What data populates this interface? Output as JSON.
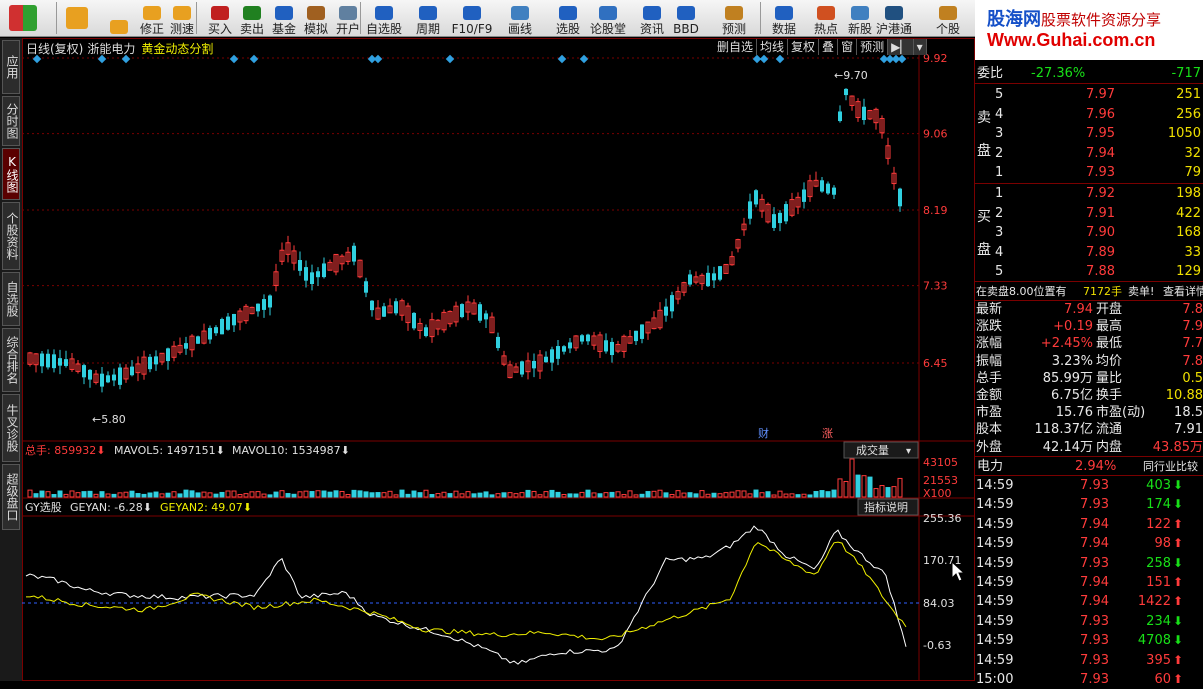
{
  "toolbar": {
    "buttons": [
      {
        "label": "",
        "icon": "flag-icon"
      },
      {
        "label": "",
        "icon": "back-arrow-icon"
      },
      {
        "label": "",
        "icon": "down-arrow-icon"
      },
      {
        "label": "修正",
        "icon": "clock-icon"
      },
      {
        "label": "测速",
        "icon": "timer-icon"
      },
      {
        "label": "买入",
        "icon": "buy-icon"
      },
      {
        "label": "卖出",
        "icon": "sell-icon"
      },
      {
        "label": "基金",
        "icon": "fund-icon"
      },
      {
        "label": "模拟",
        "icon": "hammer-icon"
      },
      {
        "label": "开户",
        "icon": "pe-icon"
      },
      {
        "label": "自选股",
        "icon": "star-icon"
      },
      {
        "label": "周期",
        "icon": "period-icon"
      },
      {
        "label": "F10/F9",
        "icon": "f10-icon"
      },
      {
        "label": "画线",
        "icon": "pen-icon"
      },
      {
        "label": "选股",
        "icon": "screen-icon"
      },
      {
        "label": "论股堂",
        "icon": "talk-icon"
      },
      {
        "label": "资讯",
        "icon": "news-icon"
      },
      {
        "label": "BBD",
        "icon": "bbd-icon"
      },
      {
        "label": "预测",
        "icon": "forecast-icon"
      },
      {
        "label": "数据",
        "icon": "data-icon"
      },
      {
        "label": "热点",
        "icon": "hot-icon"
      },
      {
        "label": "新股",
        "icon": "ipo-icon"
      },
      {
        "label": "沪港通",
        "icon": "hk-icon"
      },
      {
        "label": "个股",
        "icon": "stock-icon"
      }
    ]
  },
  "banner": {
    "line1a": "股海网",
    "line1b": "股票软件资源分享",
    "line2": "Www.Guhai.com.cn"
  },
  "side_tabs": [
    "应用",
    "分时图",
    "K线图",
    "个股资料",
    "自选股",
    "综合排名",
    "牛叉诊股",
    "超级盘口"
  ],
  "chart": {
    "title_period": "日线(复权)",
    "title_name": "浙能电力",
    "title_indicator": "黄金动态分割",
    "tools": [
      "删自选",
      "均线",
      "复权",
      "叠",
      "窗",
      "预测"
    ],
    "price_axis": [
      "9.92",
      "9.06",
      "8.19",
      "7.33",
      "6.45"
    ],
    "max_label": "9.70",
    "min_label": "5.80",
    "markers": [
      "财",
      "涨"
    ],
    "volume": {
      "label": "总手: 859932",
      "mavol5": "MAVOL5: 1497151",
      "mavol10": "MAVOL10: 1534987",
      "selector": "成交量",
      "axis": [
        "43105",
        "21553",
        "X100"
      ]
    },
    "indicator": {
      "name": "GY选股",
      "geyan": "GEYAN: -6.28",
      "geyan2": "GEYAN2: 49.07",
      "help": "指标说明",
      "axis": [
        "255.36",
        "170.71",
        "84.03",
        "-0.63"
      ]
    }
  },
  "quote": {
    "weibi_label": "委比",
    "weibi_pct": "-27.36%",
    "weibi_val": "-717",
    "sell_label": [
      "卖",
      "盘"
    ],
    "buy_label": [
      "买",
      "盘"
    ],
    "sell": [
      {
        "lv": "5",
        "price": "7.97",
        "vol": "251"
      },
      {
        "lv": "4",
        "price": "7.96",
        "vol": "256"
      },
      {
        "lv": "3",
        "price": "7.95",
        "vol": "1050"
      },
      {
        "lv": "2",
        "price": "7.94",
        "vol": "32"
      },
      {
        "lv": "1",
        "price": "7.93",
        "vol": "79"
      }
    ],
    "buy": [
      {
        "lv": "1",
        "price": "7.92",
        "vol": "198"
      },
      {
        "lv": "2",
        "price": "7.91",
        "vol": "422"
      },
      {
        "lv": "3",
        "price": "7.90",
        "vol": "168"
      },
      {
        "lv": "4",
        "price": "7.89",
        "vol": "33"
      },
      {
        "lv": "5",
        "price": "7.88",
        "vol": "129"
      }
    ],
    "position_note": "在卖盘8.00位置有",
    "position_vol": "7172手",
    "position_action": "卖单!",
    "position_link": "查看详情",
    "stats": [
      {
        "k1": "最新",
        "v1": "7.94",
        "k2": "开盘",
        "v2": "7.8"
      },
      {
        "k1": "涨跌",
        "v1": "+0.19",
        "k2": "最高",
        "v2": "7.9"
      },
      {
        "k1": "涨幅",
        "v1": "+2.45%",
        "k2": "最低",
        "v2": "7.7"
      },
      {
        "k1": "振幅",
        "v1": "3.23%",
        "k2": "均价",
        "v2": "7.8"
      },
      {
        "k1": "总手",
        "v1": "85.99万",
        "k2": "量比",
        "v2": "0.5"
      },
      {
        "k1": "金额",
        "v1": "6.75亿",
        "k2": "换手",
        "v2": "10.88"
      },
      {
        "k1": "市盈",
        "v1": "15.76",
        "k2": "市盈(动)",
        "v2": "18.5"
      },
      {
        "k1": "股本",
        "v1": "118.37亿",
        "k2": "流通",
        "v2": "7.91"
      },
      {
        "k1": "外盘",
        "v1": "42.14万",
        "k2": "内盘",
        "v2": "43.85万"
      }
    ],
    "sector": {
      "name": "电力",
      "pct": "2.94%",
      "link": "同行业比较"
    },
    "ticks": [
      {
        "time": "14:59",
        "price": "7.93",
        "vol": "403",
        "dir": "down"
      },
      {
        "time": "14:59",
        "price": "7.93",
        "vol": "174",
        "dir": "down"
      },
      {
        "time": "14:59",
        "price": "7.94",
        "vol": "122",
        "dir": "up"
      },
      {
        "time": "14:59",
        "price": "7.94",
        "vol": "98",
        "dir": "up"
      },
      {
        "time": "14:59",
        "price": "7.93",
        "vol": "258",
        "dir": "down"
      },
      {
        "time": "14:59",
        "price": "7.94",
        "vol": "151",
        "dir": "up"
      },
      {
        "time": "14:59",
        "price": "7.94",
        "vol": "1422",
        "dir": "up"
      },
      {
        "time": "14:59",
        "price": "7.93",
        "vol": "234",
        "dir": "down"
      },
      {
        "time": "14:59",
        "price": "7.93",
        "vol": "4708",
        "dir": "down"
      },
      {
        "time": "14:59",
        "price": "7.93",
        "vol": "395",
        "dir": "up"
      },
      {
        "time": "15:00",
        "price": "7.93",
        "vol": "60",
        "dir": "up"
      }
    ]
  },
  "colors": {
    "up": "#ff3b3b",
    "down": "#30d0e0",
    "grid": "#7a0000",
    "geyan": "#ffffff",
    "geyan2": "#f0f000"
  }
}
